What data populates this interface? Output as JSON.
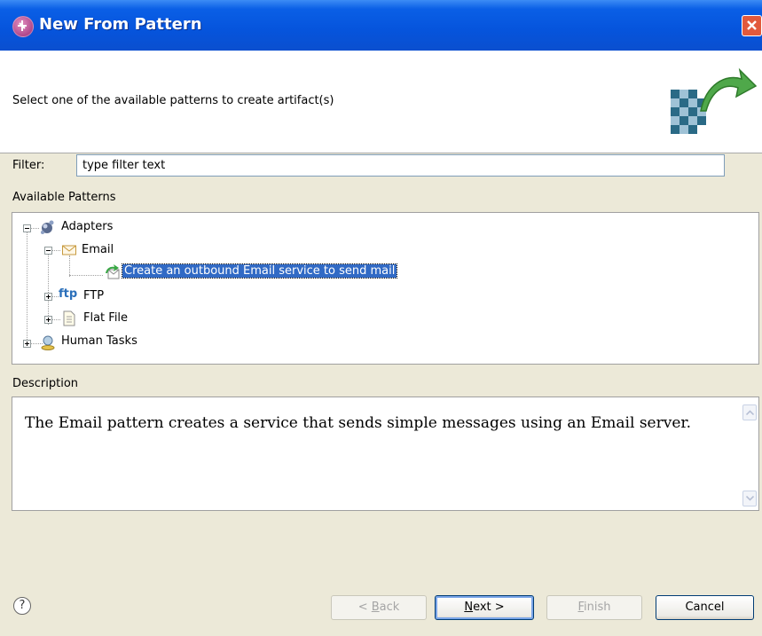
{
  "window": {
    "title": "New From Pattern"
  },
  "banner": {
    "message": "Select one of the available patterns to create artifact(s)"
  },
  "filter": {
    "label": "Filter:",
    "value": "type filter text"
  },
  "patterns": {
    "label": "Available Patterns",
    "tree": {
      "adapters": "Adapters",
      "email": "Email",
      "email_pattern": "Create an outbound Email service to send mail",
      "ftp": "FTP",
      "ftp_icon_text": "ftp",
      "flat_file": "Flat File",
      "human_tasks": "Human Tasks"
    }
  },
  "description": {
    "label": "Description",
    "text": "The Email pattern creates a service that sends simple messages using an Email server."
  },
  "buttons": {
    "help": "?",
    "back_mnemonic": "B",
    "back_rest": "ack",
    "back_prefix": "< ",
    "next_mnemonic": "N",
    "next_rest": "ext >",
    "finish_mnemonic": "F",
    "finish_rest": "inish",
    "cancel": "Cancel"
  },
  "colors": {
    "selection": "#316ac5",
    "titlebar": "#0654dc",
    "dialog_bg": "#ece9d8"
  }
}
